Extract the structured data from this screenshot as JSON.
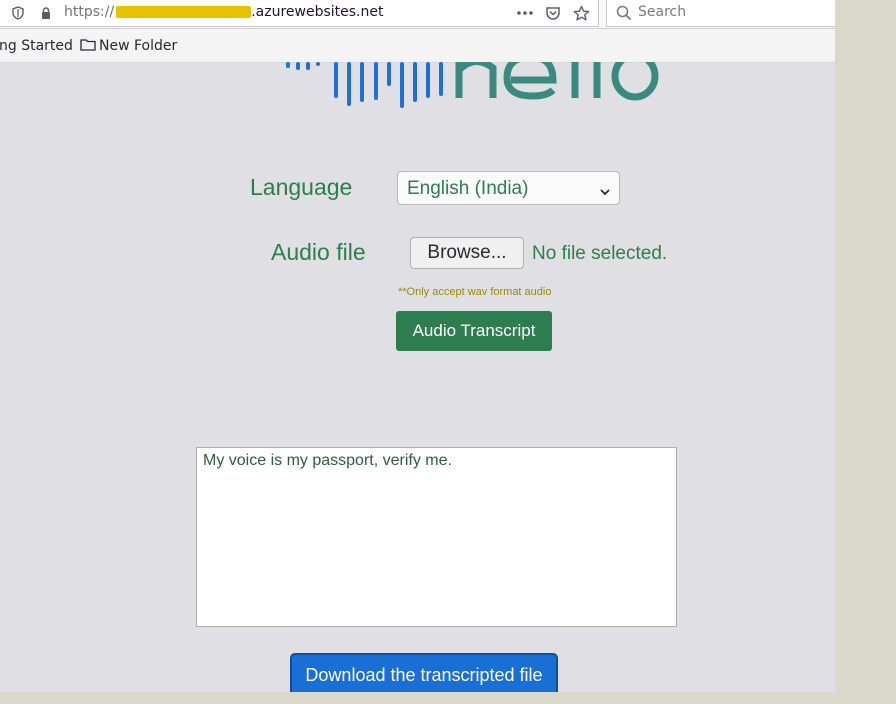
{
  "browser": {
    "url_prefix": "https://",
    "url_domain": ".azurewebsites.net",
    "search_placeholder": "Search",
    "bookmarks": [
      "ng Started",
      "New Folder"
    ]
  },
  "form": {
    "language_label": "Language",
    "language_value": "English (India)",
    "audio_label": "Audio file",
    "browse_label": "Browse...",
    "file_status": "No file selected.",
    "hint": "**Only accept wav format audio",
    "transcribe_label": "Audio Transcript"
  },
  "result": {
    "text": "My voice is my passport, verify me."
  },
  "download_label": "Download the transcripted file",
  "colors": {
    "accent_green": "#2e7d4f",
    "download_blue": "#1a6fd6",
    "hint_yellow": "#9c8a00"
  }
}
